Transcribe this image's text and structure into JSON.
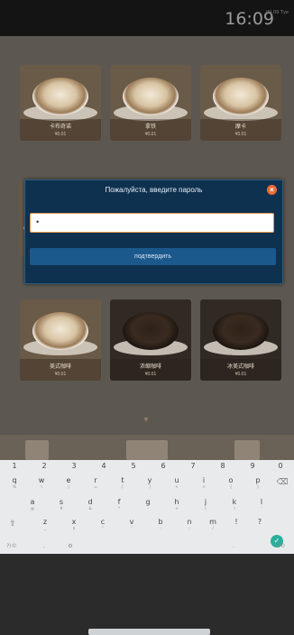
{
  "status_bar": {
    "time": "16:09",
    "time_small": "09.09\nТуе"
  },
  "tiles": [
    {
      "name": "卡布奇诺",
      "price": "¥0.01",
      "style": "light"
    },
    {
      "name": "拿铁",
      "price": "¥0.01",
      "style": "light"
    },
    {
      "name": "摩卡",
      "price": "¥0.01",
      "style": "light"
    },
    {
      "name": "美式咖啡",
      "price": "¥0.01",
      "style": "light"
    },
    {
      "name": "浓缩咖啡",
      "price": "¥0.01",
      "style": "dark"
    },
    {
      "name": "冰美式咖啡",
      "price": "¥0.01",
      "style": "dark"
    }
  ],
  "dialog": {
    "title": "Пожалуйста, введите пароль",
    "password_value": "•",
    "confirm_label": "подтвердить",
    "close_label": "×"
  },
  "keyboard": {
    "numbers": [
      "1",
      "2",
      "3",
      "4",
      "5",
      "6",
      "7",
      "8",
      "9",
      "0"
    ],
    "row1": [
      [
        "q",
        "%"
      ],
      [
        "w",
        "\\"
      ],
      [
        "e",
        "|"
      ],
      [
        "r",
        "="
      ],
      [
        "t",
        "["
      ],
      [
        "y",
        "]"
      ],
      [
        "u",
        "<"
      ],
      [
        "i",
        ">"
      ],
      [
        "o",
        "{"
      ],
      [
        "p",
        "}"
      ]
    ],
    "row2": [
      [
        "a",
        "@"
      ],
      [
        "s",
        "#"
      ],
      [
        "d",
        "&"
      ],
      [
        "f",
        "*"
      ],
      [
        "g",
        "-"
      ],
      [
        "h",
        "+"
      ],
      [
        "j",
        "("
      ],
      [
        "k",
        ")"
      ],
      [
        "l",
        "'"
      ]
    ],
    "row3": [
      [
        "z",
        "_"
      ],
      [
        "x",
        "$"
      ],
      [
        "c",
        "\""
      ],
      [
        "v",
        "'"
      ],
      [
        "b",
        ":"
      ],
      [
        "n",
        ";"
      ],
      [
        "m",
        "/"
      ],
      [
        "!",
        ""
      ],
      [
        "?",
        ""
      ]
    ],
    "bottom": [
      "?!©",
      ",",
      "⚙",
      ".",
      "?!©"
    ],
    "backspace": "⌫",
    "shift": "⇧",
    "enter": "✓"
  },
  "colors": {
    "dialog_bg": "#0f3150",
    "confirm_bg": "#1b588c",
    "close_bg": "#ef6b3c",
    "input_border": "#e39a48",
    "enter_key": "#2aaf9d"
  }
}
